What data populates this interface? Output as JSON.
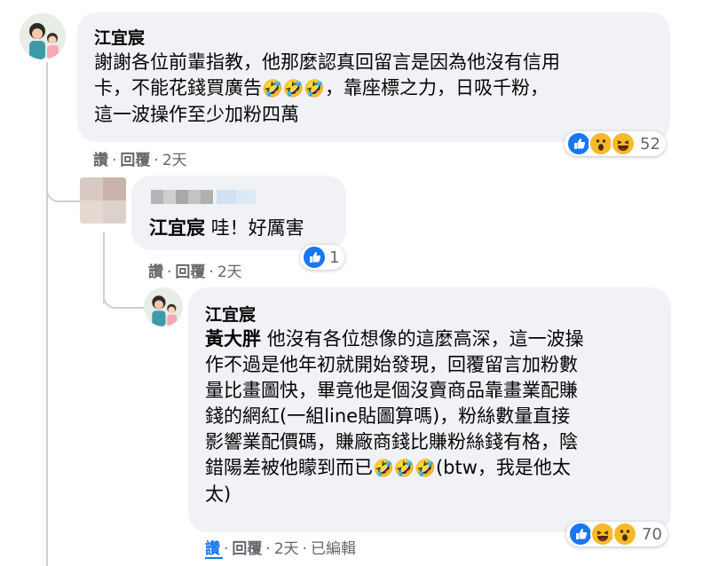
{
  "colors": {
    "bubble": "#f0f2f5",
    "like": "#1877f2",
    "haha": "#f7b928",
    "meta": "#65676b",
    "link": "#1877f2"
  },
  "comment1": {
    "author": "江宜宸",
    "lines": [
      "謝謝各位前輩指教，他那麼認真回留言是因為他沒有信用",
      "卡，不能花錢買廣告",
      "，靠座標之力，日吸千粉，",
      "這一波操作至少加粉四萬"
    ],
    "emoji": "🤣🤣🤣",
    "actions": {
      "like": "讚",
      "reply": "回覆",
      "time": "2天"
    },
    "reaction_icons": [
      "like-icon",
      "wow-icon",
      "haha-icon"
    ],
    "reaction_count": "52"
  },
  "reply1": {
    "mention": "江宜宸",
    "text": "哇！好厲害",
    "actions": {
      "like": "讚",
      "reply": "回覆",
      "time": "2天"
    },
    "reaction_icons": [
      "like-icon"
    ],
    "reaction_count": "1"
  },
  "reply2": {
    "author": "江宜宸",
    "mention": "黃大胖",
    "lines": [
      "他沒有各位想像的這麼高深，這一波操",
      "作不過是他年初就開始發現，回覆留言加粉數",
      "量比畫圖快，畢竟他是個沒賣商品靠畫業配賺",
      "錢的網紅(一組line貼圖算嗎)，粉絲數量直接",
      "影響業配價碼，賺廠商錢比賺粉絲錢有格，陰",
      "錯陽差被他矇到而已",
      "(btw，我是他太",
      "太)"
    ],
    "emoji": "🤣🤣🤣",
    "actions": {
      "like": "讚",
      "reply": "回覆",
      "time": "2天",
      "edited": "已編輯"
    },
    "reaction_icons": [
      "like-icon",
      "haha-icon",
      "wow-icon"
    ],
    "reaction_count": "70"
  }
}
